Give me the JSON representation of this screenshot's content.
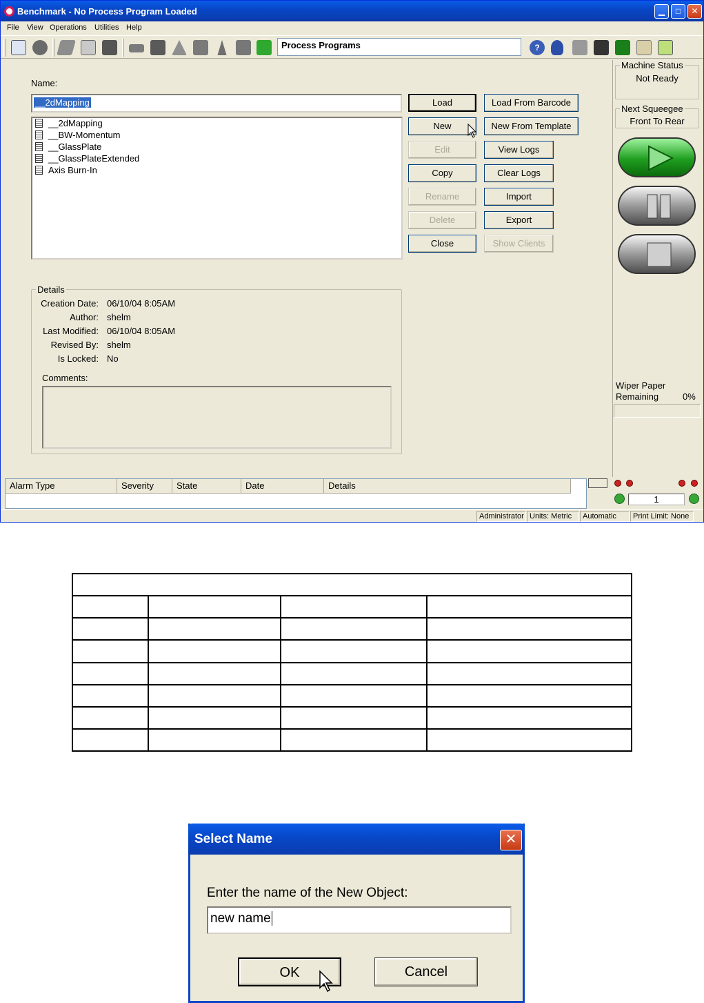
{
  "window": {
    "title": "Benchmark - No Process Program Loaded",
    "menu": [
      "File",
      "View",
      "Operations",
      "Utilities",
      "Help"
    ],
    "toolbar_field": "Process Programs"
  },
  "main": {
    "name_label": "Name:",
    "name_value": "__2dMapping",
    "programs": [
      "__2dMapping",
      "__BW-Momentum",
      "__GlassPlate",
      "__GlassPlateExtended",
      "Axis Burn-In"
    ],
    "buttons_left": [
      {
        "label": "Load",
        "enabled": true
      },
      {
        "label": "New",
        "enabled": true
      },
      {
        "label": "Edit",
        "enabled": false
      },
      {
        "label": "Copy",
        "enabled": true
      },
      {
        "label": "Rename",
        "enabled": false
      },
      {
        "label": "Delete",
        "enabled": false
      },
      {
        "label": "Close",
        "enabled": true
      }
    ],
    "buttons_right": [
      {
        "label": "Load From Barcode",
        "enabled": true
      },
      {
        "label": "New From Template",
        "enabled": true
      },
      {
        "label": "View Logs",
        "enabled": true
      },
      {
        "label": "Clear Logs",
        "enabled": true
      },
      {
        "label": "Import",
        "enabled": true
      },
      {
        "label": "Export",
        "enabled": true
      },
      {
        "label": "Show Clients",
        "enabled": false
      }
    ],
    "details": {
      "title": "Details",
      "rows": [
        {
          "label": "Creation Date:",
          "value": "06/10/04 8:05AM"
        },
        {
          "label": "Author:",
          "value": "shelm"
        },
        {
          "label": "Last Modified:",
          "value": "06/10/04 8:05AM"
        },
        {
          "label": "Revised By:",
          "value": "shelm"
        },
        {
          "label": "Is Locked:",
          "value": "No"
        }
      ],
      "comments_label": "Comments:"
    }
  },
  "right_panel": {
    "machine_status_title": "Machine Status",
    "machine_status_value": "Not Ready",
    "next_squeegee_title": "Next Squeegee",
    "next_squeegee_value": "Front To Rear",
    "wiper_label_1": "Wiper Paper",
    "wiper_label_2": "Remaining",
    "wiper_value": "0%",
    "counter": "1"
  },
  "alarms": {
    "columns": [
      "Alarm Type",
      "Severity",
      "State",
      "Date",
      "Details"
    ]
  },
  "statusbar": {
    "user": "Administrator",
    "units": "Units: Metric",
    "mode": "Automatic",
    "print_limit": "Print Limit: None"
  },
  "dialog": {
    "title": "Select Name",
    "prompt": "Enter the name of the New Object:",
    "input_value": "new name",
    "ok": "OK",
    "cancel": "Cancel"
  },
  "colors": {
    "accent": "#0a47c8",
    "selection": "#316ac5",
    "go": "#1f9e1f"
  }
}
